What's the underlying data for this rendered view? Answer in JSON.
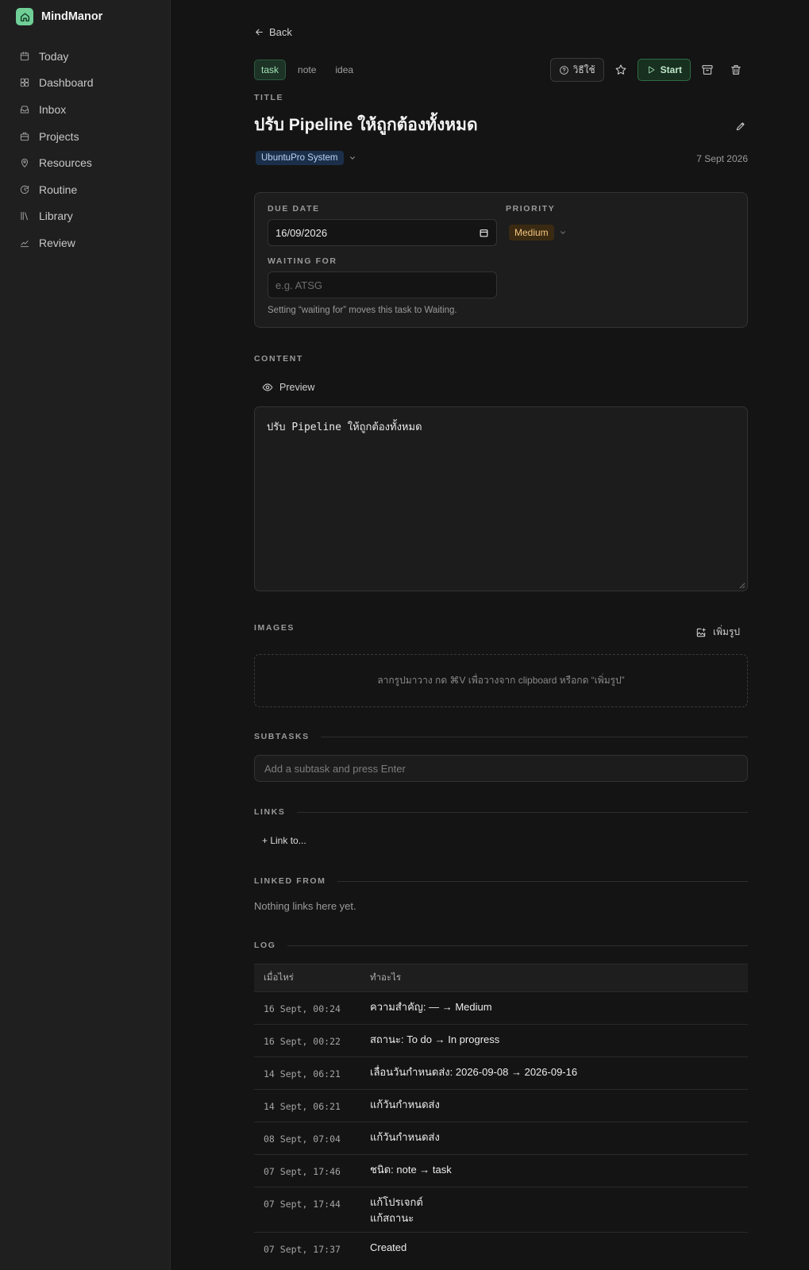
{
  "app": {
    "name": "MindManor"
  },
  "sidebar": {
    "items": [
      {
        "label": "Today",
        "icon": "today-icon"
      },
      {
        "label": "Dashboard",
        "icon": "dashboard-icon"
      },
      {
        "label": "Inbox",
        "icon": "inbox-icon"
      },
      {
        "label": "Projects",
        "icon": "projects-icon"
      },
      {
        "label": "Resources",
        "icon": "resources-icon"
      },
      {
        "label": "Routine",
        "icon": "routine-icon"
      },
      {
        "label": "Library",
        "icon": "library-icon"
      },
      {
        "label": "Review",
        "icon": "review-icon"
      }
    ]
  },
  "header": {
    "back_label": "Back",
    "types": [
      "task",
      "note",
      "idea"
    ],
    "active_type": "task",
    "howto_label": "วิธีใช้",
    "start_label": "Start"
  },
  "item": {
    "title_label": "TITLE",
    "title": "ปรับ Pipeline ให้ถูกต้องทั้งหมด",
    "project": "UbuntuPro System",
    "created_date": "7 Sept 2026"
  },
  "details": {
    "due_date_label": "DUE DATE",
    "due_date_value": "16/09/2026",
    "priority_label": "PRIORITY",
    "priority_value": "Medium",
    "waiting_for_label": "WAITING FOR",
    "waiting_for_placeholder": "e.g. ATSG",
    "waiting_hint": "Setting “waiting for” moves this task to Waiting."
  },
  "content": {
    "label": "CONTENT",
    "preview_label": "Preview",
    "text": "ปรับ Pipeline ให้ถูกต้องทั้งหมด"
  },
  "images": {
    "label": "IMAGES",
    "add_label": "เพิ่มรูป",
    "drop_hint": "ลากรูปมาวาง กด ⌘V เพื่อวางจาก clipboard หรือกด “เพิ่มรูป”"
  },
  "subtasks": {
    "label": "SUBTASKS",
    "placeholder": "Add a subtask and press Enter"
  },
  "links": {
    "label": "LINKS",
    "link_to_label": "+ Link to..."
  },
  "linked_from": {
    "label": "LINKED FROM",
    "empty": "Nothing links here yet."
  },
  "log": {
    "label": "LOG",
    "col_when": "เมื่อไหร่",
    "col_what": "ทำอะไร",
    "rows": [
      {
        "when": "16 Sept, 00:24",
        "what": [
          "ความสำคัญ: — → Medium"
        ]
      },
      {
        "when": "16 Sept, 00:22",
        "what": [
          "สถานะ: To do → In progress"
        ]
      },
      {
        "when": "14 Sept, 06:21",
        "what": [
          "เลื่อนวันกำหนดส่ง: 2026-09-08 → 2026-09-16"
        ]
      },
      {
        "when": "14 Sept, 06:21",
        "what": [
          "แก้วันกำหนดส่ง"
        ]
      },
      {
        "when": "08 Sept, 07:04",
        "what": [
          "แก้วันกำหนดส่ง"
        ]
      },
      {
        "when": "07 Sept, 17:46",
        "what": [
          "ชนิด: note → task"
        ]
      },
      {
        "when": "07 Sept, 17:44",
        "what": [
          "แก้โปรเจกต์",
          "แก้สถานะ"
        ]
      },
      {
        "when": "07 Sept, 17:37",
        "what": [
          "Created"
        ]
      }
    ]
  },
  "colors": {
    "background": "#141414",
    "sidebar": "#1e1f1e",
    "accent_green": "#6fcf97",
    "project_badge": "#1c2f4a",
    "priority_badge": "#3b2a12"
  }
}
